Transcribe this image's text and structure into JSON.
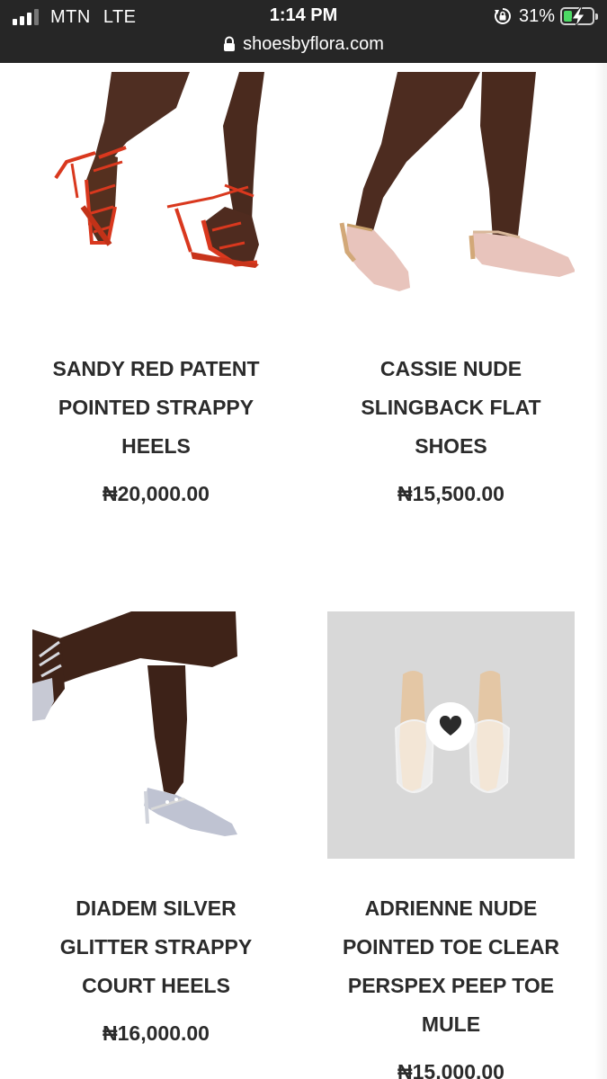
{
  "status_bar": {
    "carrier": "MTN",
    "network": "LTE",
    "time": "1:14 PM",
    "battery_percent": "31%",
    "battery_level": 0.31,
    "icons": [
      "signal-icon",
      "rotation-lock-icon",
      "battery-charging-icon",
      "lock-icon"
    ]
  },
  "browser": {
    "url": "shoesbyflora.com"
  },
  "products": [
    {
      "title_lines": [
        "SANDY RED PATENT",
        "POINTED STRAPPY",
        "HEELS"
      ],
      "price": "₦20,000.00"
    },
    {
      "title_lines": [
        "CASSIE NUDE",
        "SLINGBACK FLAT",
        "SHOES"
      ],
      "price": "₦15,500.00"
    },
    {
      "title_lines": [
        "DIADEM SILVER",
        "GLITTER STRAPPY",
        "COURT HEELS"
      ],
      "price": "₦16,000.00"
    },
    {
      "title_lines": [
        "ADRIENNE NUDE",
        "POINTED TOE CLEAR",
        "PERSPEX PEEP TOE",
        "MULE"
      ],
      "price": "₦15,000.00",
      "wishlist_icon": "heart-icon"
    }
  ],
  "colors": {
    "status_bar_bg": "#262626",
    "text": "#2b2b2b",
    "battery_green": "#4cd964",
    "red_heel": "#d9381e",
    "nude_flat": "#e8c4bc",
    "photo_grey": "#d8d8d8"
  }
}
